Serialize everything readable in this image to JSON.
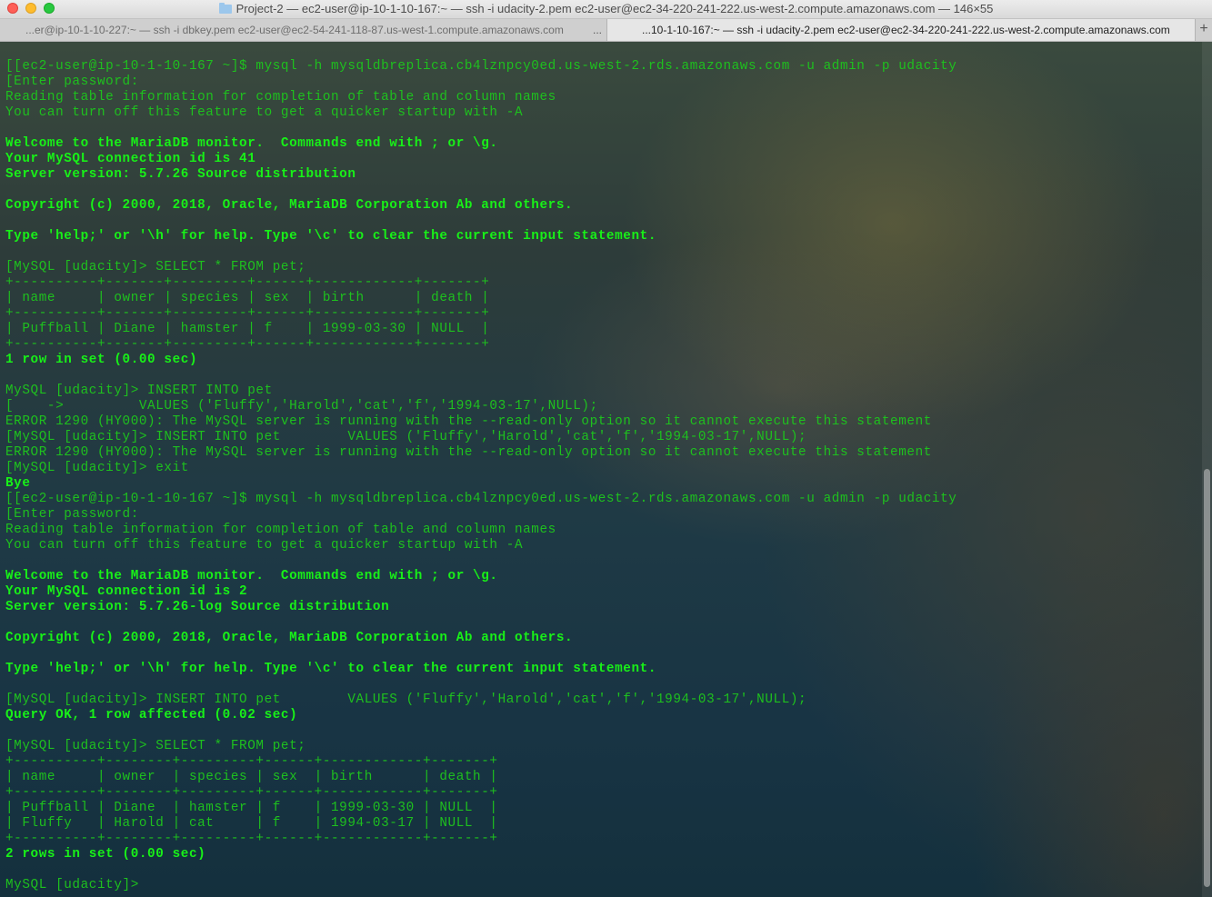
{
  "window": {
    "title": "Project-2 — ec2-user@ip-10-1-10-167:~ — ssh -i udacity-2.pem ec2-user@ec2-34-220-241-222.us-west-2.compute.amazonaws.com — 146×55"
  },
  "tabs": [
    {
      "label": "...er@ip-10-1-10-227:~ — ssh -i dbkey.pem ec2-user@ec2-54-241-118-87.us-west-1.compute.amazonaws.com",
      "active": false
    },
    {
      "label": "...10-1-10-167:~ — ssh -i udacity-2.pem ec2-user@ec2-34-220-241-222.us-west-2.compute.amazonaws.com",
      "active": true
    }
  ],
  "tab_overflow": "...",
  "tab_add": "+",
  "colors": {
    "terminal_text": "#18f018"
  },
  "terminal_lines": [
    {
      "text": "[[ec2-user@ip-10-1-10-167 ~]$ mysql -h mysqldbreplica.cb4lznpcy0ed.us-west-2.rds.amazonaws.com -u admin -p udacity",
      "bold": false
    },
    {
      "text": "[Enter password:",
      "bold": false
    },
    {
      "text": "Reading table information for completion of table and column names",
      "bold": false
    },
    {
      "text": "You can turn off this feature to get a quicker startup with -A",
      "bold": false
    },
    {
      "text": "",
      "bold": false
    },
    {
      "text": "Welcome to the MariaDB monitor.  Commands end with ; or \\g.",
      "bold": true
    },
    {
      "text": "Your MySQL connection id is 41",
      "bold": true
    },
    {
      "text": "Server version: 5.7.26 Source distribution",
      "bold": true
    },
    {
      "text": "",
      "bold": false
    },
    {
      "text": "Copyright (c) 2000, 2018, Oracle, MariaDB Corporation Ab and others.",
      "bold": true
    },
    {
      "text": "",
      "bold": false
    },
    {
      "text": "Type 'help;' or '\\h' for help. Type '\\c' to clear the current input statement.",
      "bold": true
    },
    {
      "text": "",
      "bold": false
    },
    {
      "text": "[MySQL [udacity]> SELECT * FROM pet;",
      "bold": false
    },
    {
      "text": "+----------+-------+---------+------+------------+-------+",
      "bold": false
    },
    {
      "text": "| name     | owner | species | sex  | birth      | death |",
      "bold": false
    },
    {
      "text": "+----------+-------+---------+------+------------+-------+",
      "bold": false
    },
    {
      "text": "| Puffball | Diane | hamster | f    | 1999-03-30 | NULL  |",
      "bold": false
    },
    {
      "text": "+----------+-------+---------+------+------------+-------+",
      "bold": false
    },
    {
      "text": "1 row in set (0.00 sec)",
      "bold": true
    },
    {
      "text": "",
      "bold": false
    },
    {
      "text": "MySQL [udacity]> INSERT INTO pet",
      "bold": false
    },
    {
      "text": "[    ->         VALUES ('Fluffy','Harold','cat','f','1994-03-17',NULL);",
      "bold": false
    },
    {
      "text": "ERROR 1290 (HY000): The MySQL server is running with the --read-only option so it cannot execute this statement",
      "bold": false
    },
    {
      "text": "[MySQL [udacity]> INSERT INTO pet        VALUES ('Fluffy','Harold','cat','f','1994-03-17',NULL);",
      "bold": false
    },
    {
      "text": "ERROR 1290 (HY000): The MySQL server is running with the --read-only option so it cannot execute this statement",
      "bold": false
    },
    {
      "text": "[MySQL [udacity]> exit",
      "bold": false
    },
    {
      "text": "Bye",
      "bold": true
    },
    {
      "text": "[[ec2-user@ip-10-1-10-167 ~]$ mysql -h mysqldbreplica.cb4lznpcy0ed.us-west-2.rds.amazonaws.com -u admin -p udacity",
      "bold": false
    },
    {
      "text": "[Enter password:",
      "bold": false
    },
    {
      "text": "Reading table information for completion of table and column names",
      "bold": false
    },
    {
      "text": "You can turn off this feature to get a quicker startup with -A",
      "bold": false
    },
    {
      "text": "",
      "bold": false
    },
    {
      "text": "Welcome to the MariaDB monitor.  Commands end with ; or \\g.",
      "bold": true
    },
    {
      "text": "Your MySQL connection id is 2",
      "bold": true
    },
    {
      "text": "Server version: 5.7.26-log Source distribution",
      "bold": true
    },
    {
      "text": "",
      "bold": false
    },
    {
      "text": "Copyright (c) 2000, 2018, Oracle, MariaDB Corporation Ab and others.",
      "bold": true
    },
    {
      "text": "",
      "bold": false
    },
    {
      "text": "Type 'help;' or '\\h' for help. Type '\\c' to clear the current input statement.",
      "bold": true
    },
    {
      "text": "",
      "bold": false
    },
    {
      "text": "[MySQL [udacity]> INSERT INTO pet        VALUES ('Fluffy','Harold','cat','f','1994-03-17',NULL);",
      "bold": false
    },
    {
      "text": "Query OK, 1 row affected (0.02 sec)",
      "bold": true
    },
    {
      "text": "",
      "bold": false
    },
    {
      "text": "[MySQL [udacity]> SELECT * FROM pet;",
      "bold": false
    },
    {
      "text": "+----------+--------+---------+------+------------+-------+",
      "bold": false
    },
    {
      "text": "| name     | owner  | species | sex  | birth      | death |",
      "bold": false
    },
    {
      "text": "+----------+--------+---------+------+------------+-------+",
      "bold": false
    },
    {
      "text": "| Puffball | Diane  | hamster | f    | 1999-03-30 | NULL  |",
      "bold": false
    },
    {
      "text": "| Fluffy   | Harold | cat     | f    | 1994-03-17 | NULL  |",
      "bold": false
    },
    {
      "text": "+----------+--------+---------+------+------------+-------+",
      "bold": false
    },
    {
      "text": "2 rows in set (0.00 sec)",
      "bold": true
    },
    {
      "text": "",
      "bold": false
    },
    {
      "text": "MySQL [udacity]> ",
      "bold": false
    }
  ]
}
